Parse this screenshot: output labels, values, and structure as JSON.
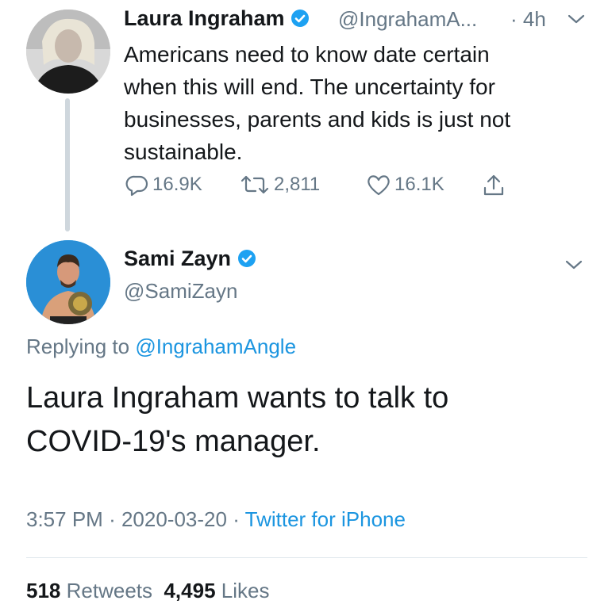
{
  "tweet1": {
    "author_name": "Laura Ingraham",
    "handle": "@IngrahamA...",
    "time": "· 4h",
    "text_lines": [
      "Americans need to know date certain",
      "when this will end.  The uncertainty for",
      "businesses, parents and kids is just not",
      "sustainable."
    ],
    "replies": "16.9K",
    "retweets": "2,811",
    "likes": "16.1K",
    "icons": [
      "verified-badge-icon",
      "chevron-down-icon",
      "reply-icon",
      "retweet-icon",
      "heart-icon",
      "share-icon"
    ]
  },
  "tweet2": {
    "author_name": "Sami Zayn",
    "handle": "@SamiZayn",
    "replying_prefix": "Replying to",
    "replying_mention": "@IngrahamAngle",
    "text_lines": [
      "Laura Ingraham wants to talk to",
      "COVID-19's manager."
    ],
    "time": "3:57 PM",
    "date": "2020-03-20",
    "source": "Twitter for iPhone",
    "retweet_count": "518",
    "retweet_label": "Retweets",
    "like_count": "4,495",
    "like_label": "Likes"
  },
  "colors": {
    "text": "#14171a",
    "muted": "#657786",
    "link": "#1b95e0",
    "verified": "#1da1f2",
    "thread_line": "#cfd7dd"
  }
}
